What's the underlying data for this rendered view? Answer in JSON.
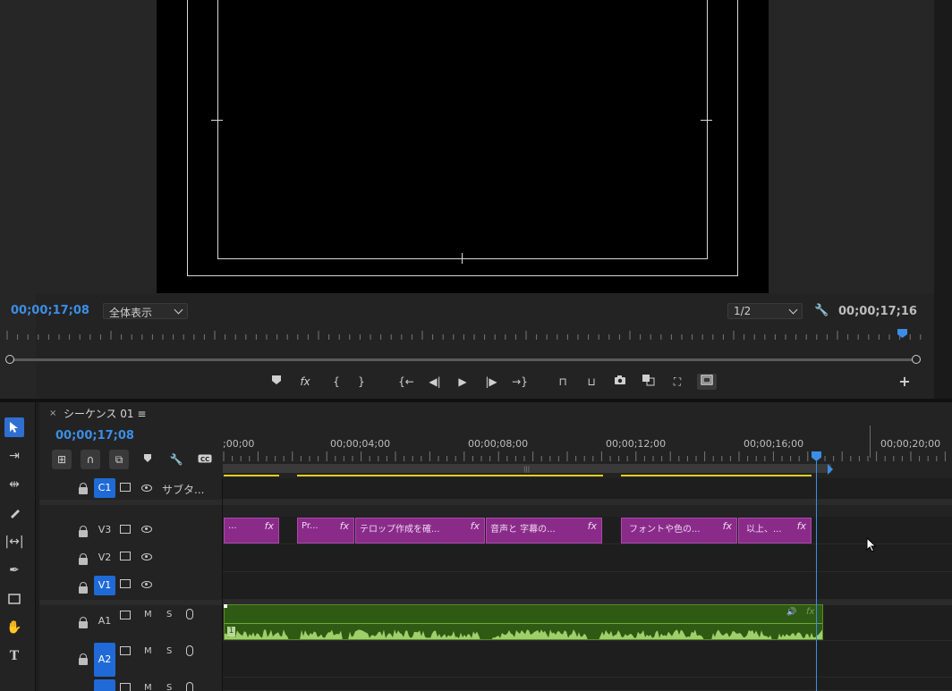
{
  "monitor": {
    "timecode_current": "00;00;17;08",
    "fit_option": "全体表示",
    "resolution": "1/2",
    "timecode_duration": "00;00;17;16"
  },
  "transport_icons": [
    "marker-icon",
    "fx-icon",
    "mark-in-icon",
    "mark-out-icon",
    "go-to-in-icon",
    "step-back-icon",
    "play-icon",
    "step-forward-icon",
    "go-to-out-icon",
    "lift-icon",
    "extract-icon",
    "camera-icon",
    "comparison-icon",
    "vr-icon",
    "safe-margins-icon",
    "add-button-icon"
  ],
  "tools": [
    "selection-tool",
    "track-select-tool",
    "ripple-edit-tool",
    "razor-tool",
    "slip-tool",
    "pen-tool",
    "rectangle-tool",
    "hand-tool",
    "type-tool"
  ],
  "timeline": {
    "sequence_name": "シーケンス 01",
    "menu_glyph": "≡",
    "close_glyph": "×",
    "timecode": "00;00;17;08",
    "ruler_labels": [
      ";00;00",
      "00;00;04;00",
      "00;00;08;00",
      "00;00;12;00",
      "00;00;16;00",
      "00;00;20;00"
    ]
  },
  "tracks": {
    "c1": {
      "label": "C1",
      "title": "サブタ..."
    },
    "v3": {
      "label": "V3"
    },
    "v2": {
      "label": "V2"
    },
    "v1": {
      "label": "V1"
    },
    "a1": {
      "label": "A1",
      "m": "M",
      "s": "S"
    },
    "a2": {
      "label": "A2",
      "m": "M",
      "s": "S"
    },
    "a3": {
      "m": "M",
      "s": "S"
    }
  },
  "v3_clips": [
    {
      "text": "...",
      "fx": "fx"
    },
    {
      "text": "Pr...",
      "fx": "fx"
    },
    {
      "text": "テロップ作成を確...",
      "fx": "fx"
    },
    {
      "text": "音声と 字幕の...",
      "fx": "fx"
    },
    {
      "text": "フォントや色の...",
      "fx": "fx"
    },
    {
      "text": "以上、...",
      "fx": "fx"
    }
  ],
  "audio_clip": {
    "channel": "1",
    "fx": "fx"
  },
  "colors": {
    "accent": "#3b8ee6",
    "clip_purple": "#8a2b8a",
    "audio_green": "#2f5a14",
    "work_yellow": "#e3d21a"
  }
}
